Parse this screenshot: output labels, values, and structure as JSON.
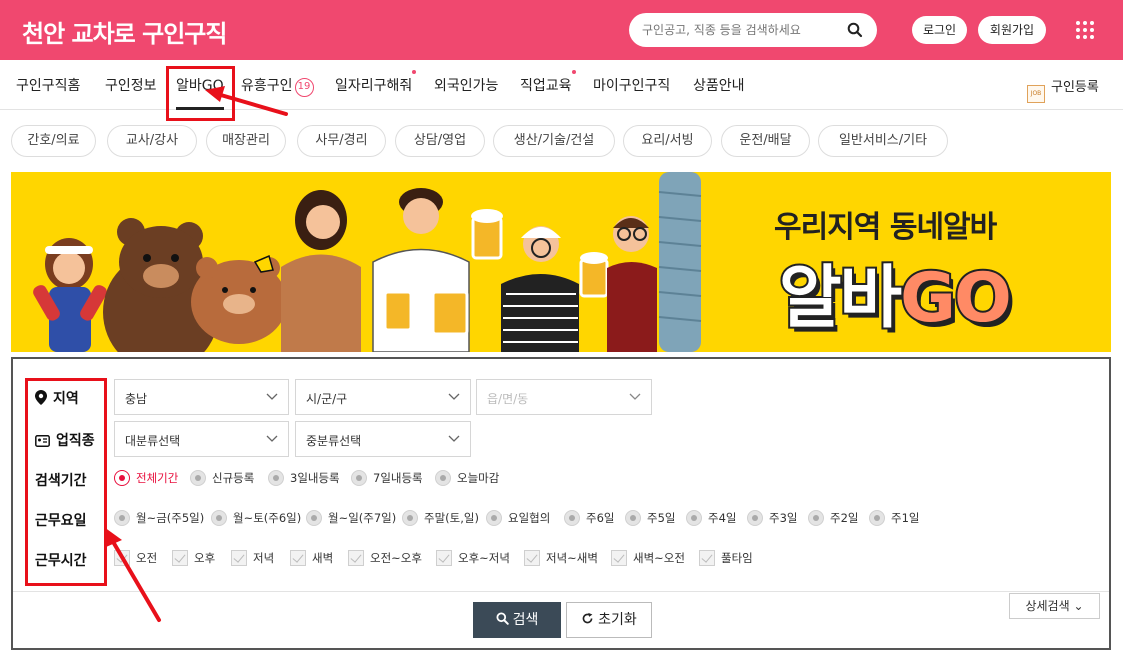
{
  "header": {
    "brand": "천안 교차로 구인구직",
    "search_placeholder": "구인공고, 직종 등을 검색하세요",
    "login_label": "로그인",
    "join_label": "회원가입"
  },
  "nav": {
    "items": [
      {
        "label": "구인구직홈"
      },
      {
        "label": "구인정보"
      },
      {
        "label": "알바GO"
      },
      {
        "label": "유흥구인"
      },
      {
        "label": "일자리구해줘"
      },
      {
        "label": "외국인가능"
      },
      {
        "label": "직업교육"
      },
      {
        "label": "마이구인구직"
      },
      {
        "label": "상품안내"
      }
    ],
    "adult_badge": "19",
    "post_job_label": "구인등록",
    "post_job_icon_text": "JOB"
  },
  "categories": [
    "간호/의료",
    "교사/강사",
    "매장관리",
    "사무/경리",
    "상담/영업",
    "생산/기술/건설",
    "요리/서빙",
    "운전/배달",
    "일반서비스/기타"
  ],
  "banner": {
    "tagline": "우리지역 동네알바",
    "logo_main": "알바",
    "logo_go": "GO"
  },
  "filters": {
    "region": {
      "label": "지역",
      "province": "충남",
      "city": "시/군/구",
      "town": "읍/면/동"
    },
    "job_type": {
      "label": "업직종",
      "major": "대분류선택",
      "minor": "중분류선택"
    },
    "period": {
      "label": "검색기간",
      "options": [
        "전체기간",
        "신규등록",
        "3일내등록",
        "7일내등록",
        "오늘마감"
      ],
      "selected": "전체기간"
    },
    "work_days": {
      "label": "근무요일",
      "options": [
        "월~금(주5일)",
        "월~토(주6일)",
        "월~일(주7일)",
        "주말(토,일)",
        "요일협의",
        "주6일",
        "주5일",
        "주4일",
        "주3일",
        "주2일",
        "주1일"
      ]
    },
    "work_hours": {
      "label": "근무시간",
      "options": [
        "오전",
        "오후",
        "저녁",
        "새벽",
        "오전~오후",
        "오후~저녁",
        "저녁~새벽",
        "새벽~오전",
        "풀타임"
      ]
    }
  },
  "actions": {
    "search_label": "검색",
    "reset_label": "초기화",
    "detail_label": "상세검색"
  },
  "colors": {
    "brand_pink": "#f0486f",
    "banner_yellow": "#ffd600",
    "annotation_red": "#e8101a"
  }
}
